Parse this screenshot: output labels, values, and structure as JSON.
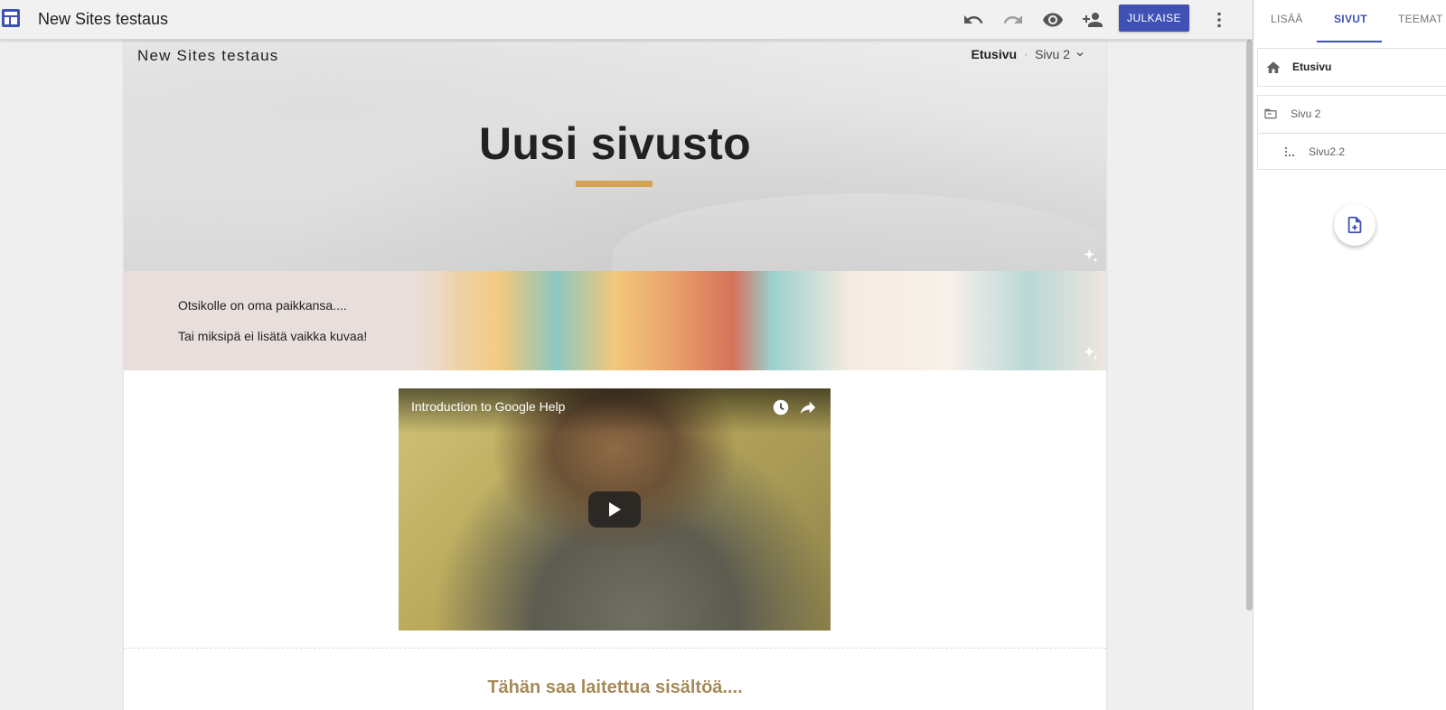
{
  "app": {
    "document_title": "New Sites testaus",
    "logo_icon": "sites-logo-icon",
    "accent_color": "#3f51b5"
  },
  "toolbar": {
    "undo_icon": "undo-icon",
    "redo_icon": "redo-icon",
    "preview_icon": "eye-icon",
    "share_icon": "add-person-icon",
    "publish_label": "JULKAISE",
    "more_icon": "more-vert-icon"
  },
  "site": {
    "site_name": "New Sites testaus",
    "nav": {
      "home": "Etusivu",
      "separator": "·",
      "page2": "Sivu 2"
    },
    "hero": {
      "title": "Uusi sivusto",
      "underline_color": "#d4a551"
    },
    "band": {
      "line1": "Otsikolle on oma paikkansa....",
      "line2": "Tai miksipä ei lisätä vaikka kuvaa!"
    },
    "video": {
      "title": "Introduction to Google Help",
      "watch_later_icon": "clock-icon",
      "share_icon": "share-arrow-icon",
      "play_icon": "play-icon"
    },
    "content_heading": "Tähän saa laitettua sisältöä....",
    "heading_color": "#a58a5a"
  },
  "panel": {
    "tabs": [
      {
        "label": "LISÄÄ",
        "active": false
      },
      {
        "label": "SIVUT",
        "active": true
      },
      {
        "label": "TEEMAT",
        "active": false
      }
    ],
    "pages": {
      "home": {
        "label": "Etusivu",
        "icon": "home-icon"
      },
      "group": {
        "label": "Sivu 2",
        "icon": "folder-icon"
      },
      "child": {
        "label": "Sivu2.2",
        "icon": "subpage-icon"
      }
    },
    "add_page_icon": "add-page-icon"
  }
}
